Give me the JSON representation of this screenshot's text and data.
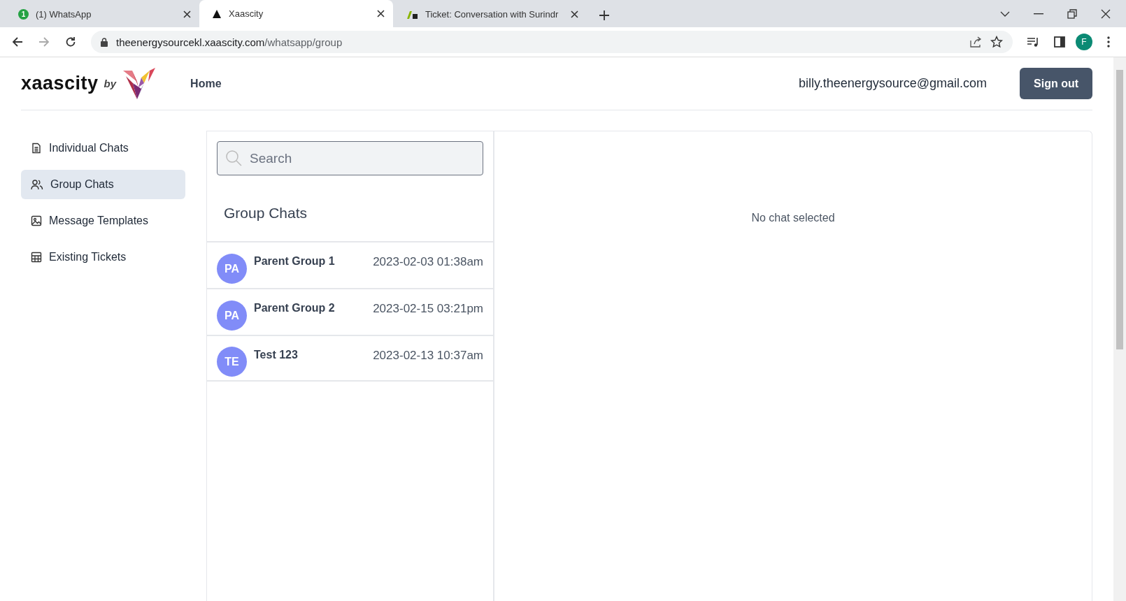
{
  "browser": {
    "tabs": [
      {
        "title": "(1) WhatsApp",
        "kind": "badge",
        "badge": "1",
        "selected": false
      },
      {
        "title": "Xaascity",
        "kind": "triangle",
        "selected": true
      },
      {
        "title": "Ticket: Conversation with Surindr",
        "kind": "ticket",
        "selected": false
      }
    ],
    "url_host": "theenergysourcekl.xaascity.com",
    "url_path": "/whatsapp/group",
    "profile": "F"
  },
  "header": {
    "logo": "xaascity",
    "logo_by": "by",
    "nav": [
      "Home"
    ],
    "email": "billy.theenergysource@gmail.com",
    "sign_out": "Sign out"
  },
  "sidebar": {
    "items": [
      {
        "label": "Individual Chats",
        "kind": "document",
        "selected": false
      },
      {
        "label": "Group Chats",
        "kind": "users",
        "selected": true
      },
      {
        "label": "Message Templates",
        "kind": "image",
        "selected": false
      },
      {
        "label": "Existing Tickets",
        "kind": "table",
        "selected": false
      }
    ]
  },
  "chat_list": {
    "search": {
      "placeholder": "Search"
    },
    "title": "Group Chats",
    "chats": [
      {
        "initials": "PA",
        "name": "Parent Group 1",
        "time": "2023-02-03 01:38am"
      },
      {
        "initials": "PA",
        "name": "Parent Group 2",
        "time": "2023-02-15 03:21pm"
      },
      {
        "initials": "TE",
        "name": "Test 123",
        "time": "2023-02-13 10:37am"
      }
    ]
  },
  "chat_view": {
    "empty_text": "No chat selected"
  }
}
